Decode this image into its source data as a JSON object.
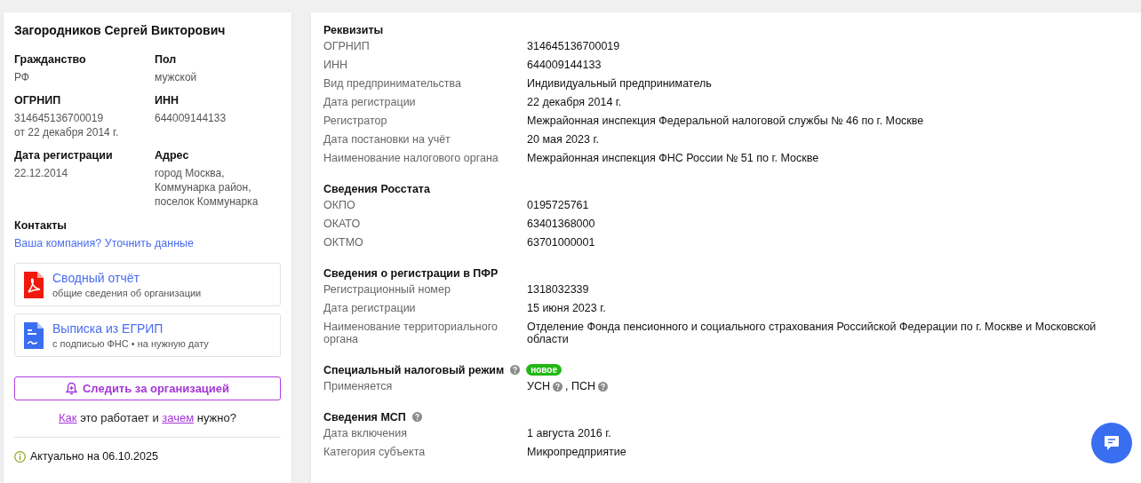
{
  "person": {
    "name": "Загородников Сергей Викторович",
    "fields": [
      {
        "label": "Гражданство",
        "lines": [
          "РФ"
        ]
      },
      {
        "label": "Пол",
        "lines": [
          "мужской"
        ]
      },
      {
        "label": "ОГРНИП",
        "lines": [
          "314645136700019",
          "от 22 декабря 2014 г."
        ]
      },
      {
        "label": "ИНН",
        "lines": [
          "644009144133"
        ]
      },
      {
        "label": "Дата регистрации",
        "lines": [
          "22.12.2014"
        ]
      },
      {
        "label": "Адрес",
        "lines": [
          "город Москва,",
          "Коммунарка район,",
          "поселок Коммунарка"
        ]
      }
    ],
    "contacts_title": "Контакты",
    "contacts_link": "Ваша компания? Уточнить данные",
    "documents": [
      {
        "kind": "pdf",
        "title": "Сводный отчёт",
        "subtitle": "общие сведения об организации"
      },
      {
        "kind": "doc",
        "title": "Выписка из ЕГРИП",
        "subtitle": "с подписью ФНС • на нужную дату"
      }
    ],
    "follow_button": "Следить за организацией",
    "how_text": [
      {
        "text": "Как",
        "link": true
      },
      {
        "text": " это работает и ",
        "link": false
      },
      {
        "text": "зачем",
        "link": true
      },
      {
        "text": " нужно?",
        "link": false
      }
    ],
    "updated": "Актуально на 06.10.2025"
  },
  "sections": [
    {
      "title": "Реквизиты",
      "help": false,
      "rows": [
        {
          "label": "ОГРНИП",
          "value": "314645136700019"
        },
        {
          "label": "ИНН",
          "value": "644009144133"
        },
        {
          "label": "Вид предпринимательства",
          "value": "Индивидуальный предприниматель"
        },
        {
          "label": "Дата регистрации",
          "value": "22 декабря 2014 г."
        },
        {
          "label": "Регистратор",
          "value": "Межрайонная инспекция Федеральной налоговой службы № 46 по г. Москве"
        },
        {
          "label": "Дата постановки на учёт",
          "value": "20 мая 2023 г."
        },
        {
          "label": "Наименование налогового органа",
          "value": "Межрайонная инспекция ФНС России № 51 по г. Москве"
        }
      ]
    },
    {
      "title": "Сведения Росстата",
      "help": false,
      "rows": [
        {
          "label": "ОКПО",
          "value": "0195725761"
        },
        {
          "label": "ОКАТО",
          "value": "63401368000"
        },
        {
          "label": "ОКТМО",
          "value": "63701000001"
        }
      ]
    },
    {
      "title": "Сведения о регистрации в ПФР",
      "help": false,
      "rows": [
        {
          "label": "Регистрационный номер",
          "value": "1318032339"
        },
        {
          "label": "Дата регистрации",
          "value": "15 июня 2023 г."
        },
        {
          "label": "Наименование территориального органа",
          "value": "Отделение Фонда пенсионного и социального страхования Российской Федерации по г. Москве и Московской области"
        }
      ]
    },
    {
      "title": "Специальный налоговый режим",
      "help": true,
      "badge": "новое",
      "rows": [
        {
          "label": "Применяется",
          "parts": [
            {
              "text": "УСН",
              "help": true
            },
            {
              "text": ", ПСН",
              "help": true
            }
          ]
        }
      ]
    },
    {
      "title": "Сведения МСП",
      "help": true,
      "rows": [
        {
          "label": "Дата включения",
          "value": "1 августа 2016 г."
        },
        {
          "label": "Категория субъекта",
          "value": "Микропредприятие"
        }
      ]
    }
  ]
}
